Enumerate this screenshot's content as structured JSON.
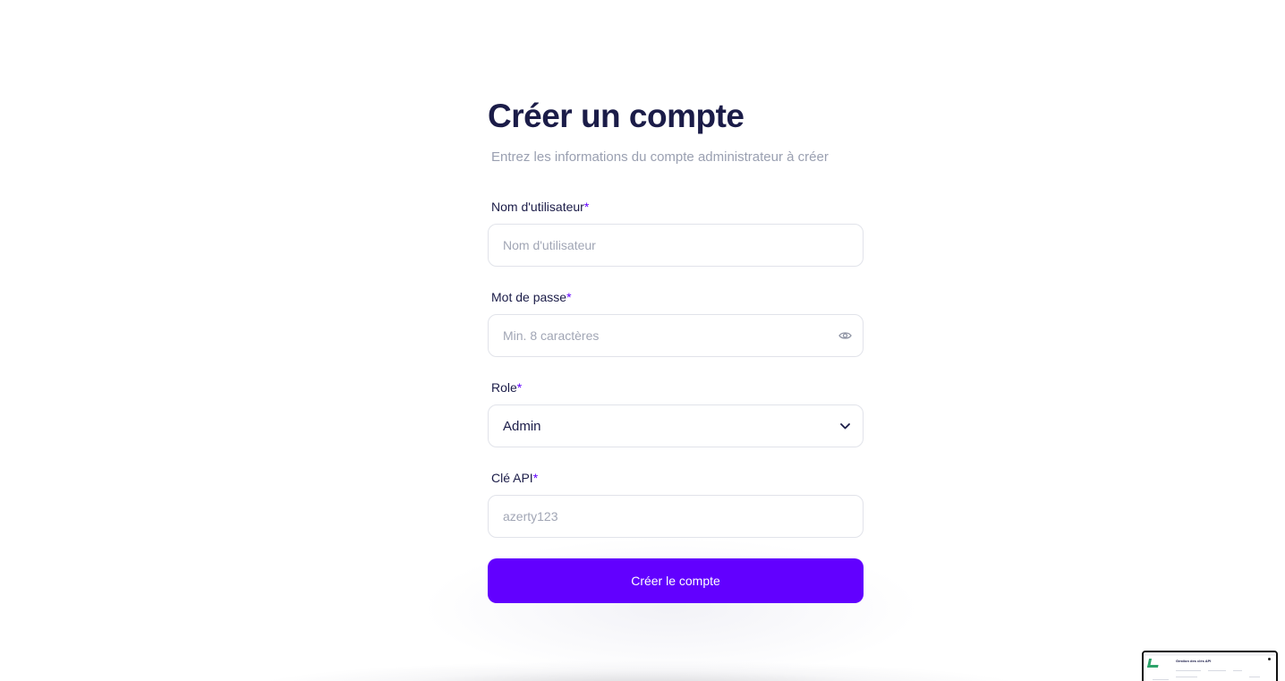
{
  "header": {
    "title": "Créer un compte",
    "subtitle": "Entrez les informations du compte administrateur à créer"
  },
  "form": {
    "username": {
      "label": "Nom d'utilisateur",
      "required_mark": "*",
      "placeholder": "Nom d'utilisateur",
      "value": ""
    },
    "password": {
      "label": "Mot de passe",
      "required_mark": "*",
      "placeholder": "Min. 8 caractères",
      "value": "",
      "icon": "eye-icon"
    },
    "role": {
      "label": "Role",
      "required_mark": "*",
      "value": "Admin",
      "icon": "chevron-down-icon"
    },
    "api_key": {
      "label": "Clé API",
      "required_mark": "*",
      "placeholder": "azerty123",
      "value": ""
    },
    "submit_label": "Créer le compte"
  },
  "thumbnail": {
    "title": "Gestion des clés API"
  },
  "colors": {
    "primary": "#6200ff",
    "heading": "#1b1c48",
    "muted": "#9aa0b1",
    "border": "#e1e3ea"
  }
}
